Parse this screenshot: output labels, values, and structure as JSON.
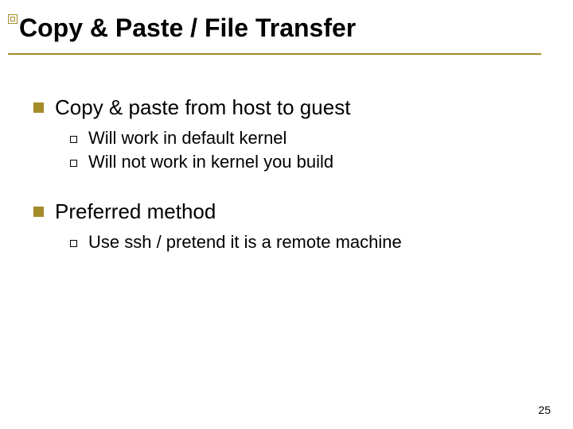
{
  "title": "Copy & Paste / File Transfer",
  "sections": [
    {
      "heading": "Copy & paste from host to guest",
      "items": [
        "Will work in default kernel",
        "Will not work in kernel you build"
      ]
    },
    {
      "heading": "Preferred method",
      "items": [
        "Use ssh / pretend it is a remote machine"
      ]
    }
  ],
  "page_number": "25"
}
